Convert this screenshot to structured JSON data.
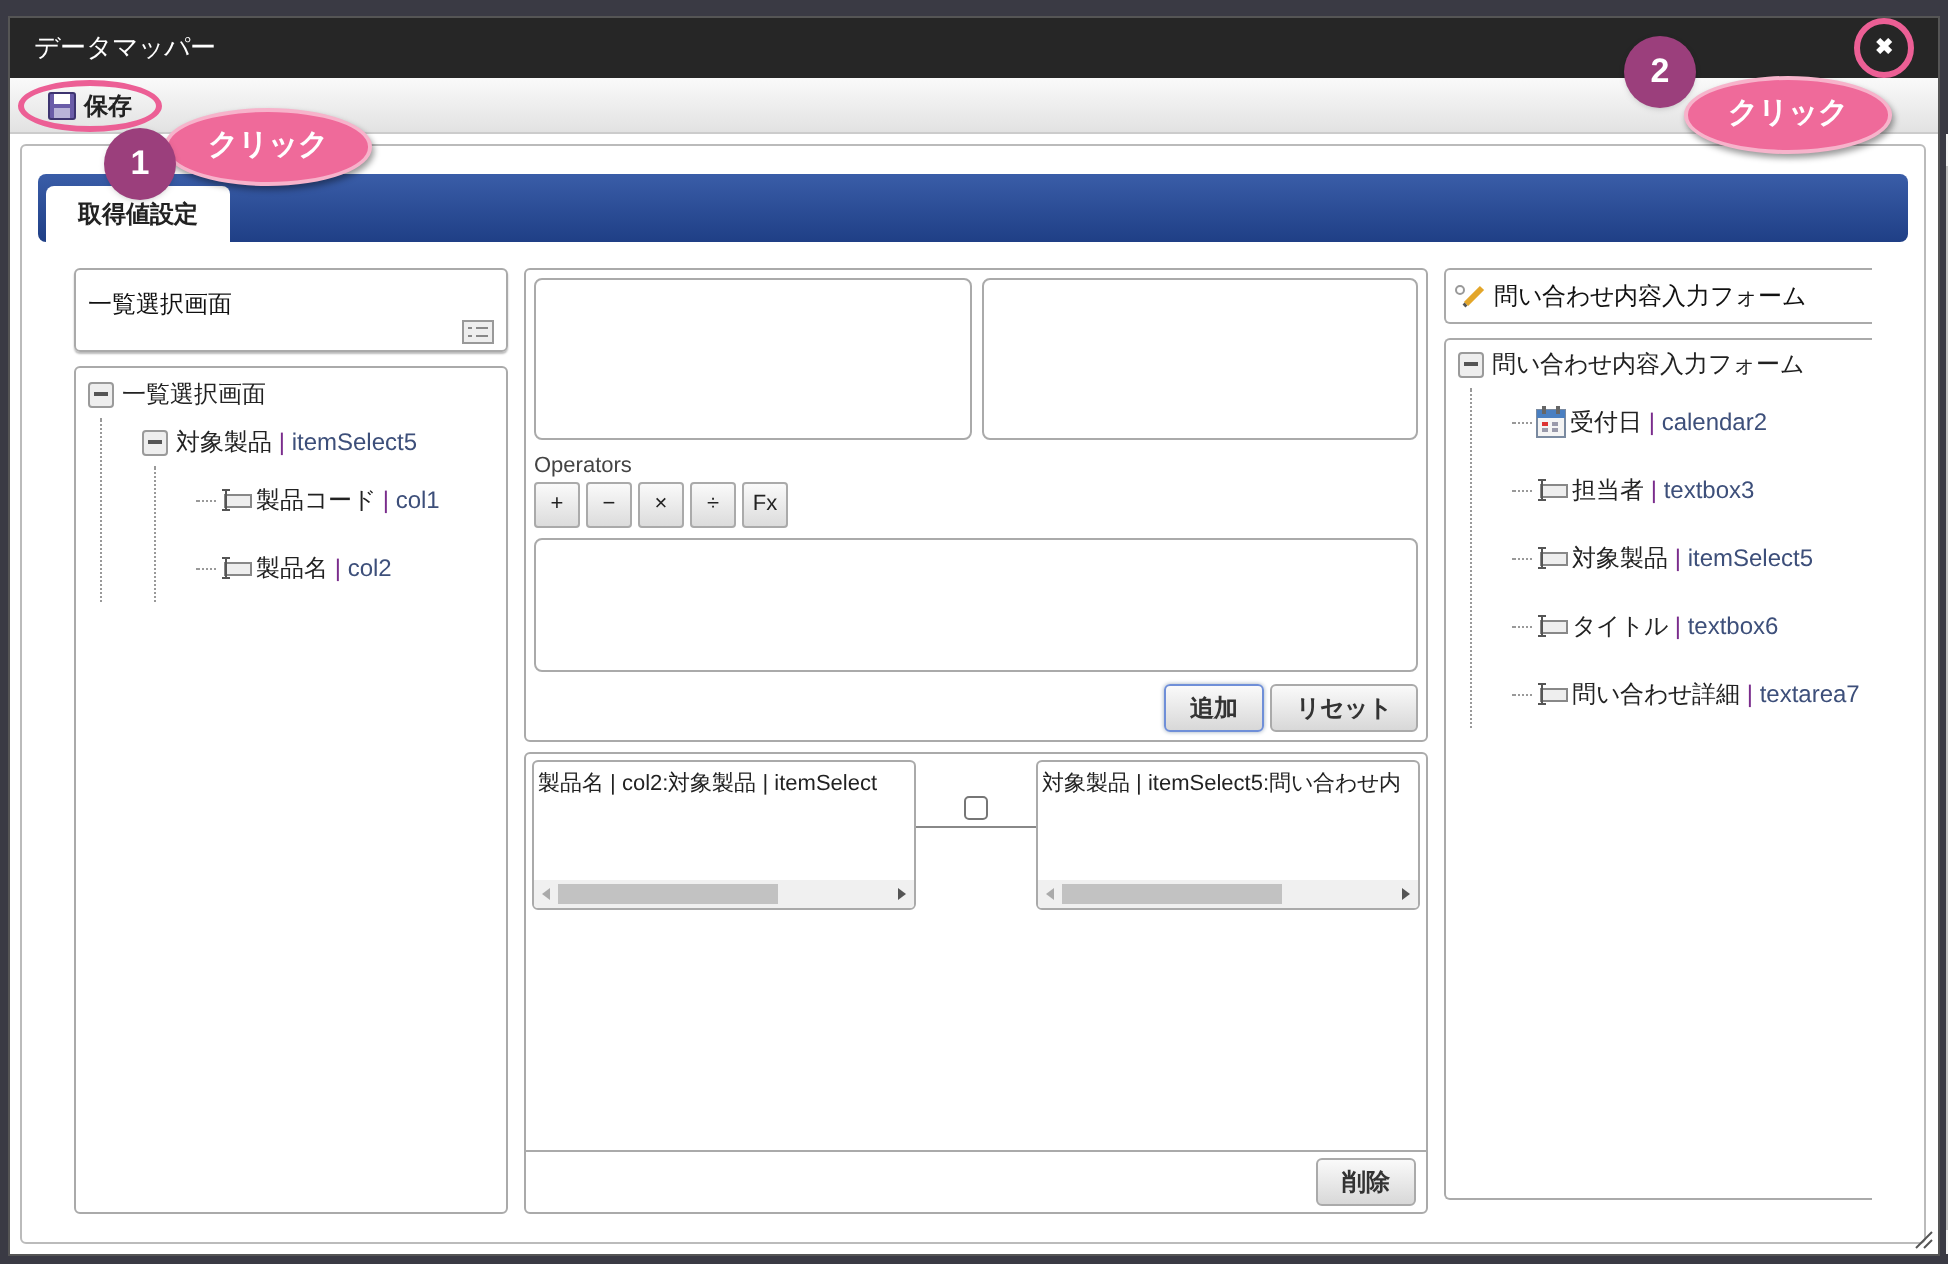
{
  "window": {
    "title": "データマッパー",
    "close_glyph": "✖"
  },
  "toolbar": {
    "save_label": "保存"
  },
  "annotations": [
    {
      "number": "1",
      "label": "クリック"
    },
    {
      "number": "2",
      "label": "クリック"
    }
  ],
  "tabs": [
    {
      "label": "取得値設定",
      "selected": true
    }
  ],
  "source": {
    "title": "一覧選択画面",
    "tree": [
      {
        "name": "一覧選択画面",
        "expanded": true,
        "children": [
          {
            "name": "対象製品",
            "separator": "|",
            "id": "itemSelect5",
            "expanded": true,
            "children": [
              {
                "name": "製品コード",
                "separator": "|",
                "id": "col1",
                "kind": "textbox"
              },
              {
                "name": "製品名",
                "separator": "|",
                "id": "col2",
                "kind": "textbox"
              }
            ]
          }
        ]
      }
    ]
  },
  "expression": {
    "operators_label": "Operators",
    "operators": [
      "+",
      "−",
      "×",
      "÷",
      "Fx"
    ],
    "buttons": [
      {
        "label": "追加",
        "focused": true
      },
      {
        "label": "リセット",
        "focused": false
      }
    ]
  },
  "mapping": {
    "left": "製品名 | col2:対象製品 | itemSelect",
    "right": "対象製品 | itemSelect5:問い合わせ内",
    "checked": false,
    "delete_label": "削除"
  },
  "target": {
    "title": "問い合わせ内容入力フォーム",
    "tree": [
      {
        "name": "問い合わせ内容入力フォーム",
        "expanded": true,
        "children": [
          {
            "name": "受付日",
            "separator": "|",
            "id": "calendar2",
            "kind": "calendar"
          },
          {
            "name": "担当者",
            "separator": "|",
            "id": "textbox3",
            "kind": "textbox"
          },
          {
            "name": "対象製品",
            "separator": "|",
            "id": "itemSelect5",
            "kind": "textbox"
          },
          {
            "name": "タイトル",
            "separator": "|",
            "id": "textbox6",
            "kind": "textbox"
          },
          {
            "name": "問い合わせ詳細",
            "separator": "|",
            "id": "textarea7",
            "kind": "textbox"
          }
        ]
      }
    ]
  }
}
